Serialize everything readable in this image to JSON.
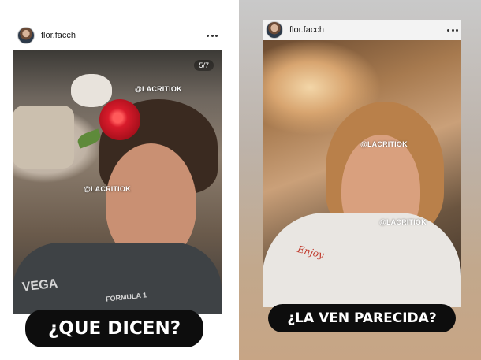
{
  "left_post": {
    "username": "flor.facch",
    "counter": "5/7",
    "watermark_top": "@LACRITIOK",
    "watermark_face": "@LACRITIOK",
    "shirt_print": "VEGA",
    "shirt_print_small": "FORMULA 1",
    "caption": "¿QUE DICEN?"
  },
  "right_post": {
    "username": "flor.facch",
    "watermark_top": "@LACRITIOK",
    "watermark_bottom": "@LACRITIOK",
    "shirt_print": "Enjoy",
    "caption": "¿LA VEN PARECIDA?"
  },
  "icons": {
    "avatar": "avatar",
    "more": "more-options-icon"
  },
  "colors": {
    "caption_bg": "#0d0d0d",
    "caption_text": "#ffffff"
  }
}
